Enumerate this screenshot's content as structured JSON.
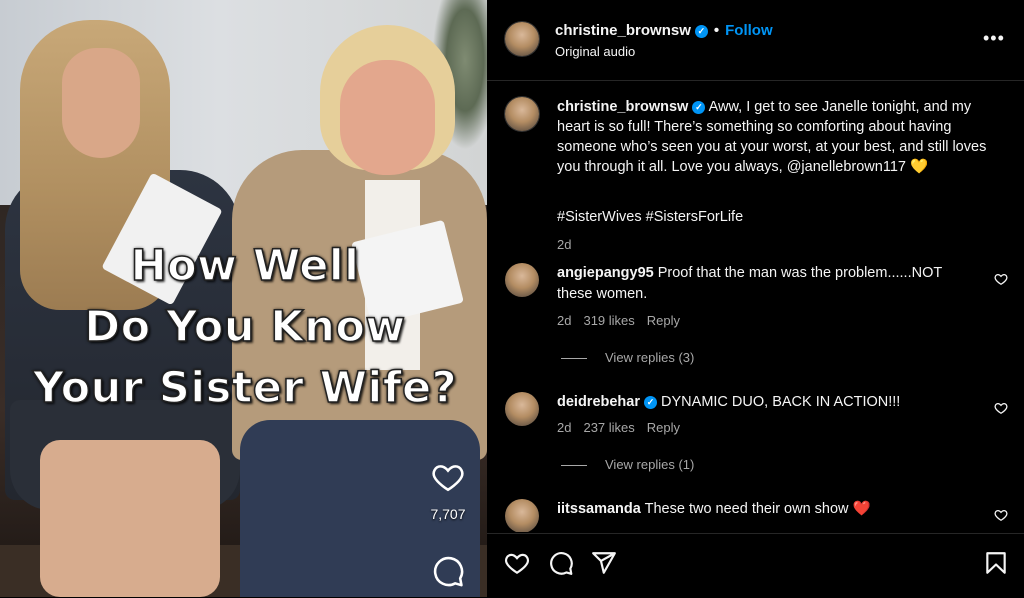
{
  "video": {
    "overlay_lines": [
      "How Well",
      "Do You Know",
      "Your Sister Wife?"
    ],
    "like_count": "7,707",
    "icons": [
      "heart-icon",
      "comment-icon"
    ]
  },
  "header": {
    "username": "christine_brownsw",
    "verified": true,
    "separator": "•",
    "follow_label": "Follow",
    "subtitle": "Original audio",
    "more_label": "•••"
  },
  "caption": {
    "username": "christine_brownsw",
    "text": "Aww, I get to see Janelle tonight, and my heart is so full! There’s something so comforting about having someone who’s seen you at your worst, at your best, and still loves you through it all. Love you always, @janellebrown117 💛",
    "hashtags": "#SisterWives #SistersForLife",
    "time": "2d"
  },
  "comments": [
    {
      "username": "angiepangy95",
      "verified": false,
      "text": "Proof that the man was the problem......NOT these women.",
      "time": "2d",
      "likes": "319 likes",
      "reply_label": "Reply",
      "view_replies": "View replies (3)"
    },
    {
      "username": "deidrebehar",
      "verified": true,
      "text": "DYNAMIC DUO, BACK IN ACTION!!!",
      "time": "2d",
      "likes": "237 likes",
      "reply_label": "Reply",
      "view_replies": "View replies (1)"
    },
    {
      "username": "iitssamanda",
      "verified": false,
      "text": "These two need their own show ❤️"
    }
  ],
  "actions": {
    "icons": [
      "heart-icon",
      "comment-icon",
      "share-icon",
      "save-icon"
    ]
  },
  "colors": {
    "background": "#000000",
    "accent": "#0095f6",
    "muted_text": "#a8a8a8",
    "heart_red": "#ff3040"
  }
}
